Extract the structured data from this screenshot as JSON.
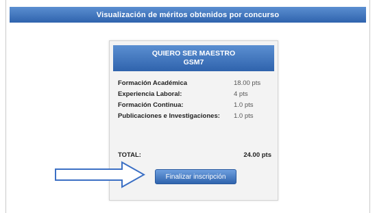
{
  "header": {
    "title": "Visualización de méritos obtenidos por concurso"
  },
  "card": {
    "title_line1": "QUIERO SER MAESTRO",
    "title_line2": "GSM7",
    "rows": [
      {
        "label": "Formación Académica",
        "value": "18.00 pts"
      },
      {
        "label": "Experiencia Laboral:",
        "value": "4 pts"
      },
      {
        "label": "Formación Continua:",
        "value": "1.0 pts"
      },
      {
        "label": "Publicaciones e Investigaciones:",
        "value": "1.0 pts"
      }
    ],
    "total_label": "TOTAL:",
    "total_value": "24.00 pts",
    "finish_button": "Finalizar inscripción"
  },
  "colors": {
    "header_blue": "#2f63ad",
    "arrow_outline": "#3b6fc4"
  },
  "icons": {
    "annotation": "arrow-right-icon"
  }
}
